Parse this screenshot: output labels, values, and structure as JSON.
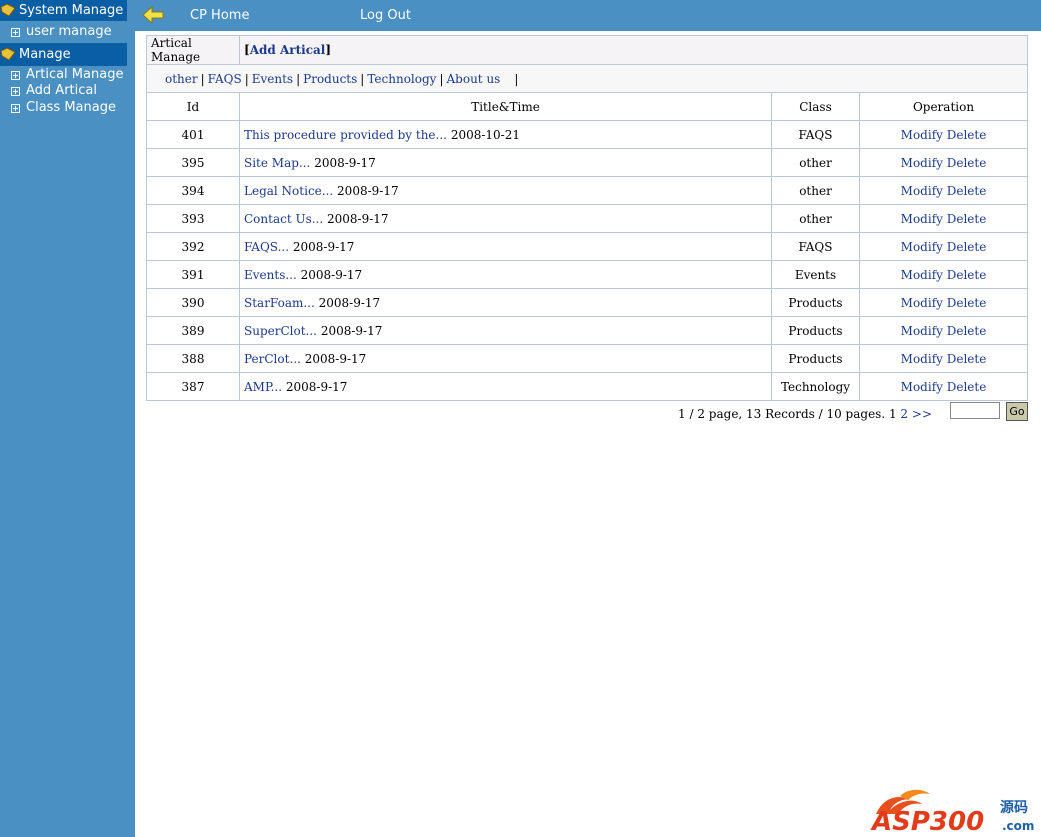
{
  "sidebar": {
    "sections": [
      {
        "label": "System Manage",
        "items": [
          {
            "label": "user manage"
          }
        ]
      },
      {
        "label": "Manage",
        "items": [
          {
            "label": "Artical Manage"
          },
          {
            "label": "Add Artical"
          },
          {
            "label": "Class Manage"
          }
        ]
      }
    ]
  },
  "topbar": {
    "home_label": "CP Home",
    "logout_label": "Log Out"
  },
  "header": {
    "section_title": "Artical Manage",
    "add_link": "Add Artical",
    "bracket_open": "[",
    "bracket_close": "]"
  },
  "class_nav": {
    "items": [
      "other",
      "FAQS",
      "Events",
      "Products",
      "Technology",
      "About us"
    ],
    "separator": "|"
  },
  "table": {
    "columns": [
      "Id",
      "Title&Time",
      "Class",
      "Operation"
    ],
    "rows": [
      {
        "id": "401",
        "title": "This procedure provided by the...",
        "date": "2008-10-21",
        "class": "FAQS"
      },
      {
        "id": "395",
        "title": "Site Map...",
        "date": "2008-9-17",
        "class": "other"
      },
      {
        "id": "394",
        "title": "Legal Notice...",
        "date": "2008-9-17",
        "class": "other"
      },
      {
        "id": "393",
        "title": "Contact Us...",
        "date": "2008-9-17",
        "class": "other"
      },
      {
        "id": "392",
        "title": "FAQS...",
        "date": "2008-9-17",
        "class": "FAQS"
      },
      {
        "id": "391",
        "title": "Events...",
        "date": "2008-9-17",
        "class": "Events"
      },
      {
        "id": "390",
        "title": "StarFoam...",
        "date": "2008-9-17",
        "class": "Products"
      },
      {
        "id": "389",
        "title": "SuperClot...",
        "date": "2008-9-17",
        "class": "Products"
      },
      {
        "id": "388",
        "title": "PerClot...",
        "date": "2008-9-17",
        "class": "Products"
      },
      {
        "id": "387",
        "title": "AMP...",
        "date": "2008-9-17",
        "class": "Technology"
      }
    ],
    "modify_label": "Modify",
    "delete_label": "Delete"
  },
  "pager": {
    "summary": "1 / 2 page, 13 Records / 10 pages. 1",
    "page_2": "2",
    "next": ">>",
    "input_value": "",
    "go_label": "Go"
  },
  "logo": {
    "text": "ASP300",
    "sub": ".com",
    "cn": "源码"
  },
  "colors": {
    "sidebar_bg": "#4a90c2",
    "sidebar_header": "#0a5ea3",
    "link": "#1c3a8a"
  }
}
